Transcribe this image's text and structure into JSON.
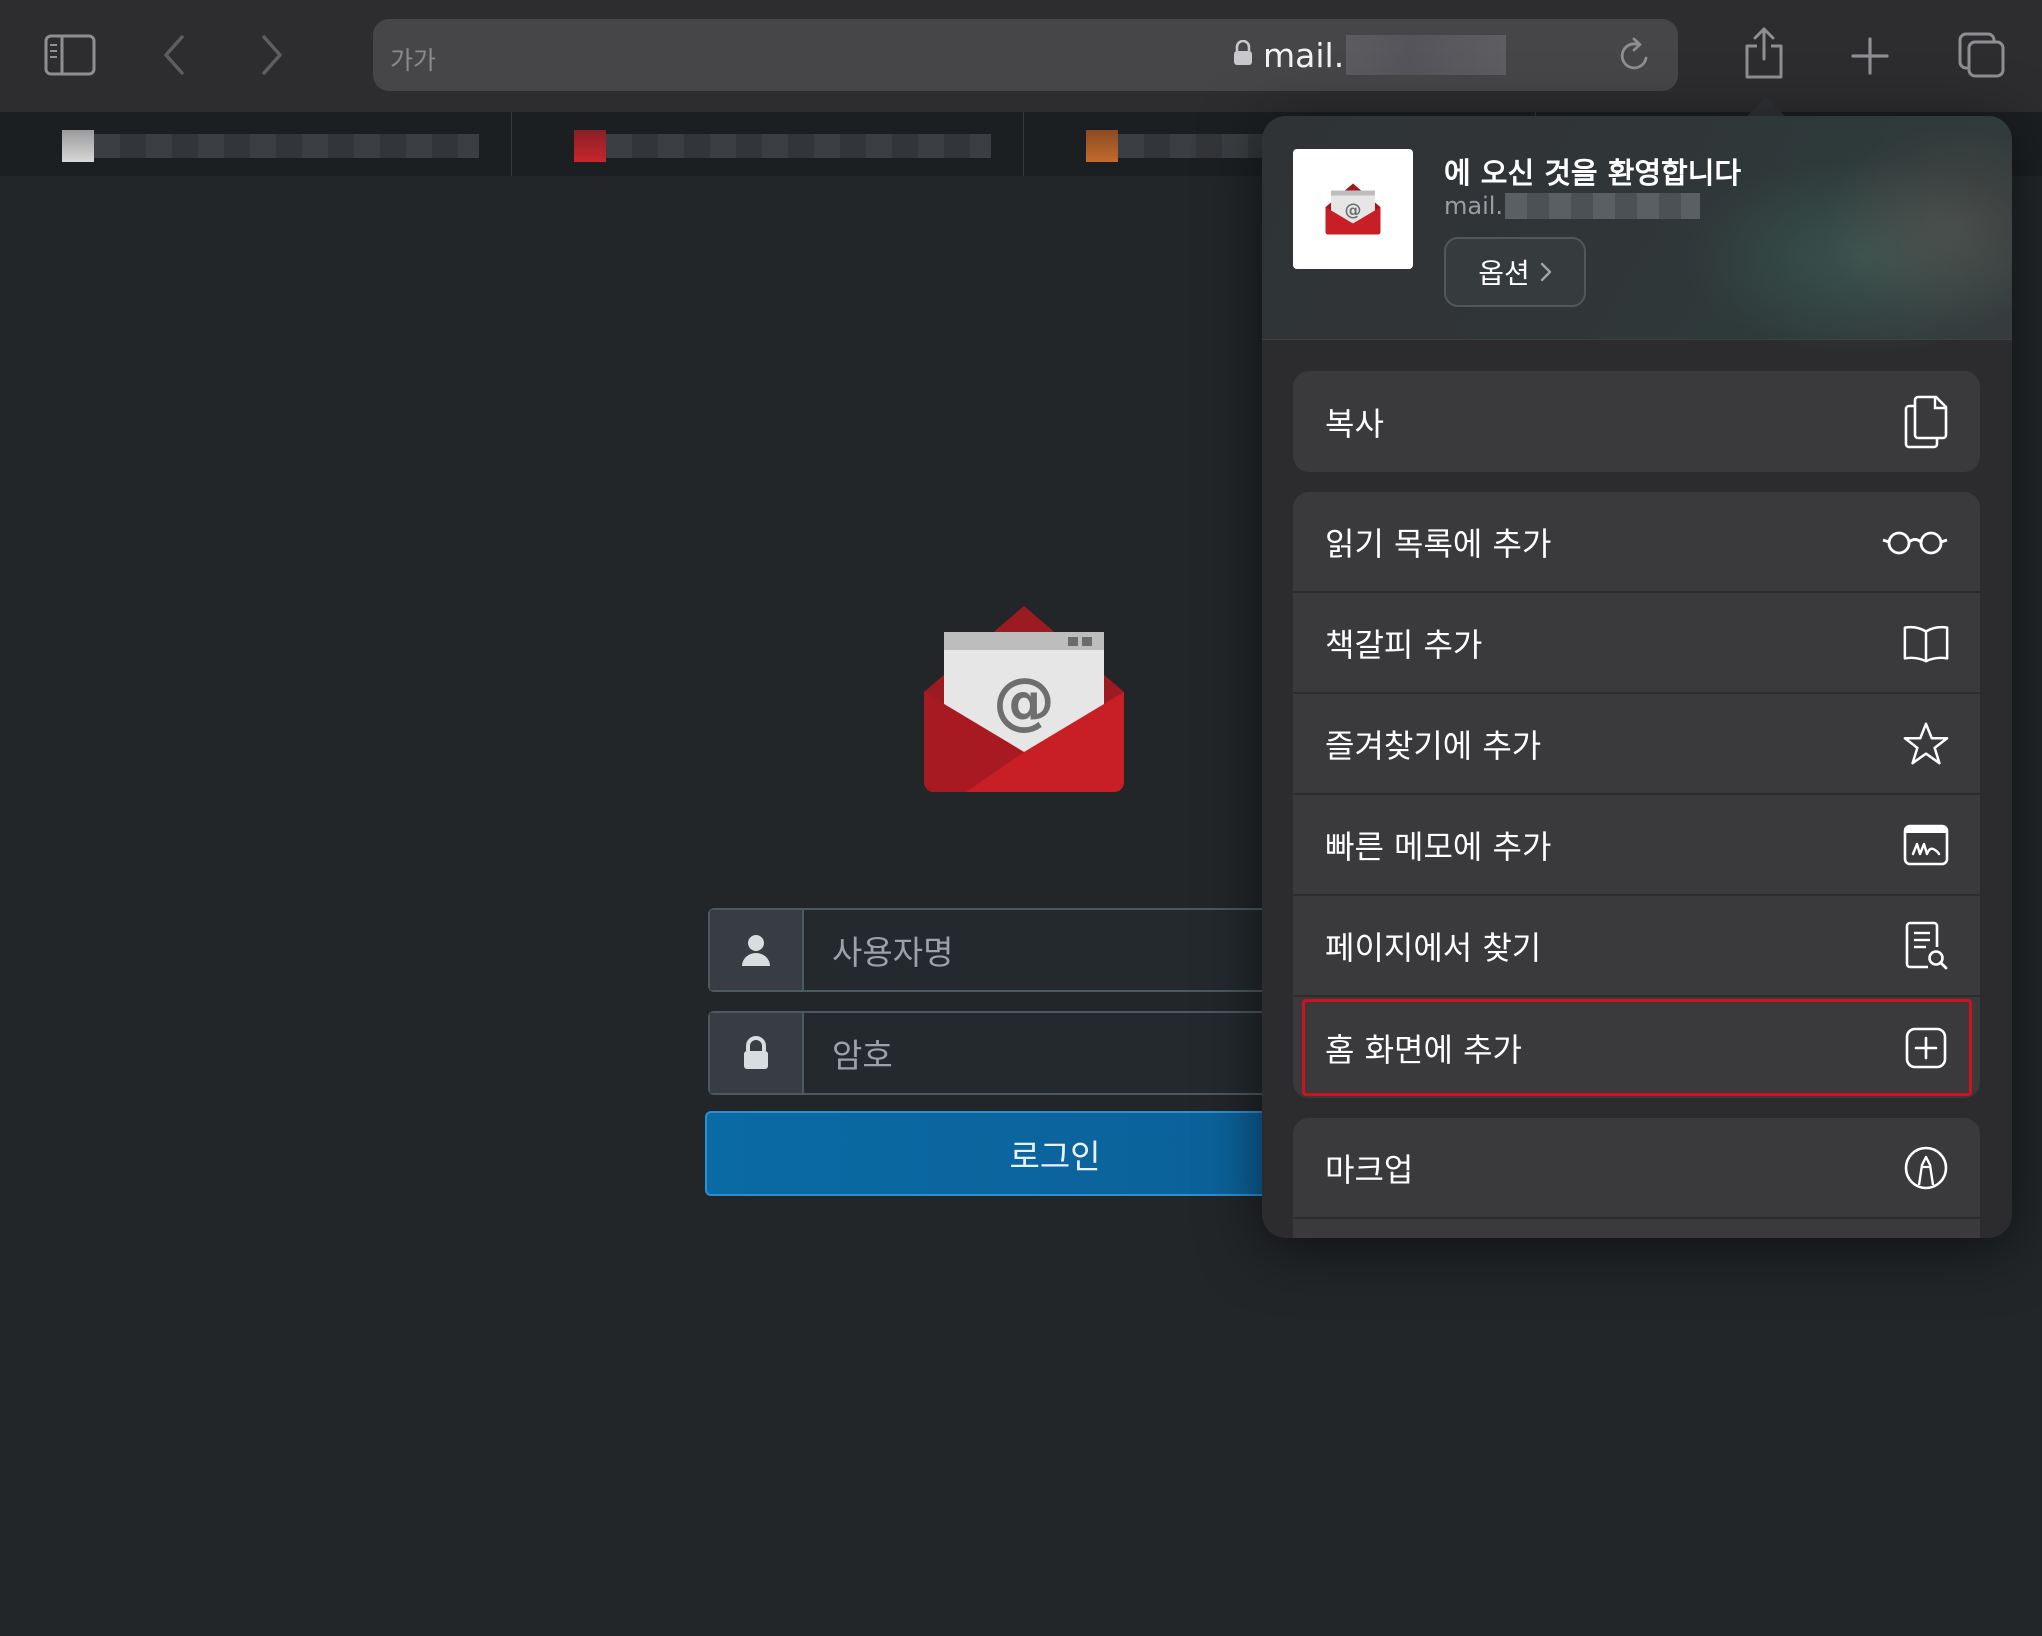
{
  "toolbar": {
    "text_size_label": "가가",
    "url_prefix": "mail.",
    "icons": [
      "sidebar-icon",
      "back-icon",
      "forward-icon",
      "lock-icon",
      "reload-icon",
      "share-icon",
      "new-tab-icon",
      "tabs-overview-icon"
    ]
  },
  "login": {
    "username_placeholder": "사용자명",
    "password_placeholder": "암호",
    "login_label": "로그인"
  },
  "share_sheet": {
    "site_title": "에 오신 것을 환영합니다",
    "site_url": "mail.",
    "options_label": "옵션",
    "actions": {
      "copy": "복사",
      "reading_list": "읽기 목록에 추가",
      "bookmark": "책갈피 추가",
      "favorites": "즐겨찾기에 추가",
      "quick_note": "빠른 메모에 추가",
      "find_on_page": "페이지에서 찾기",
      "add_home_screen": "홈 화면에 추가",
      "markup": "마크업"
    }
  },
  "colors": {
    "highlight": "#d0121e",
    "login_button": "#0a6aa4",
    "mail_red": "#c81e26"
  }
}
